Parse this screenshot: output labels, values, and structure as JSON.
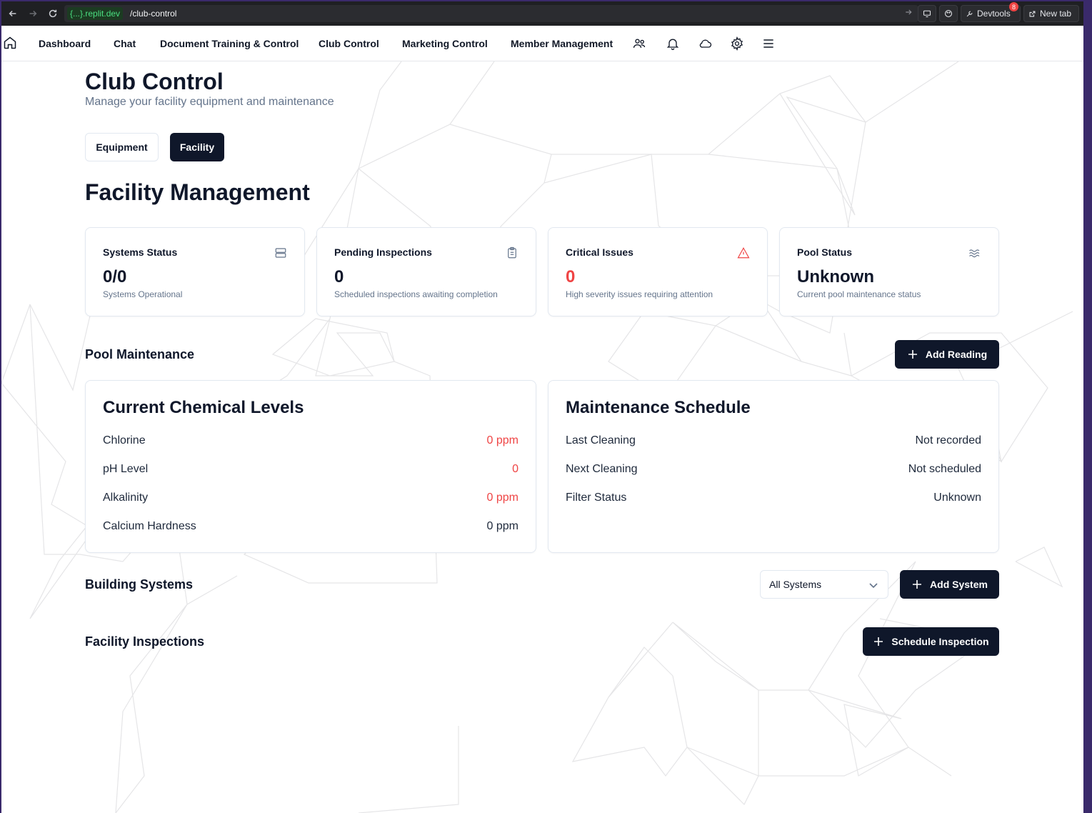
{
  "browser": {
    "domain": "{...}.replit.dev",
    "path": "/club-control",
    "devtools_label": "Devtools",
    "devtools_badge": "8",
    "new_tab_label": "New tab"
  },
  "nav": {
    "items": [
      "Dashboard",
      "Chat",
      "Document Training & Control",
      "Club Control",
      "Marketing Control",
      "Member Management"
    ],
    "icons": [
      "home-icon",
      "users-icon",
      "bell-icon",
      "cloud-icon",
      "gear-icon",
      "menu-icon"
    ]
  },
  "page": {
    "title": "Club Control",
    "subtitle": "Manage your facility equipment and maintenance",
    "tabs": [
      "Equipment",
      "Facility"
    ],
    "active_tab": "Facility"
  },
  "facility": {
    "title": "Facility Management",
    "cards": [
      {
        "label": "Systems Status",
        "value": "0/0",
        "desc": "Systems Operational",
        "icon": "server-icon"
      },
      {
        "label": "Pending Inspections",
        "value": "0",
        "desc": "Scheduled inspections awaiting completion",
        "icon": "clipboard-icon"
      },
      {
        "label": "Critical Issues",
        "value": "0",
        "desc": "High severity issues requiring attention",
        "icon": "alert-triangle-icon"
      },
      {
        "label": "Pool Status",
        "value": "Unknown",
        "desc": "Current pool maintenance status",
        "icon": "waves-icon"
      }
    ]
  },
  "pool": {
    "title": "Pool Maintenance",
    "add_reading_label": "Add Reading",
    "chemical": {
      "title": "Current Chemical Levels",
      "rows": [
        {
          "label": "Chlorine",
          "value": "0 ppm"
        },
        {
          "label": "pH Level",
          "value": "0"
        },
        {
          "label": "Alkalinity",
          "value": "0 ppm"
        },
        {
          "label": "Calcium Hardness",
          "value": "0 ppm"
        }
      ]
    },
    "schedule": {
      "title": "Maintenance Schedule",
      "rows": [
        {
          "label": "Last Cleaning",
          "value": "Not recorded"
        },
        {
          "label": "Next Cleaning",
          "value": "Not scheduled"
        },
        {
          "label": "Filter Status",
          "value": "Unknown"
        }
      ]
    }
  },
  "building": {
    "title": "Building Systems",
    "filter_value": "All Systems",
    "add_label": "Add System"
  },
  "inspections": {
    "title": "Facility Inspections",
    "schedule_label": "Schedule Inspection"
  },
  "colors": {
    "primary": "#0f172a",
    "danger": "#ef4444",
    "muted": "#64748b",
    "border": "#e2e8f0"
  }
}
